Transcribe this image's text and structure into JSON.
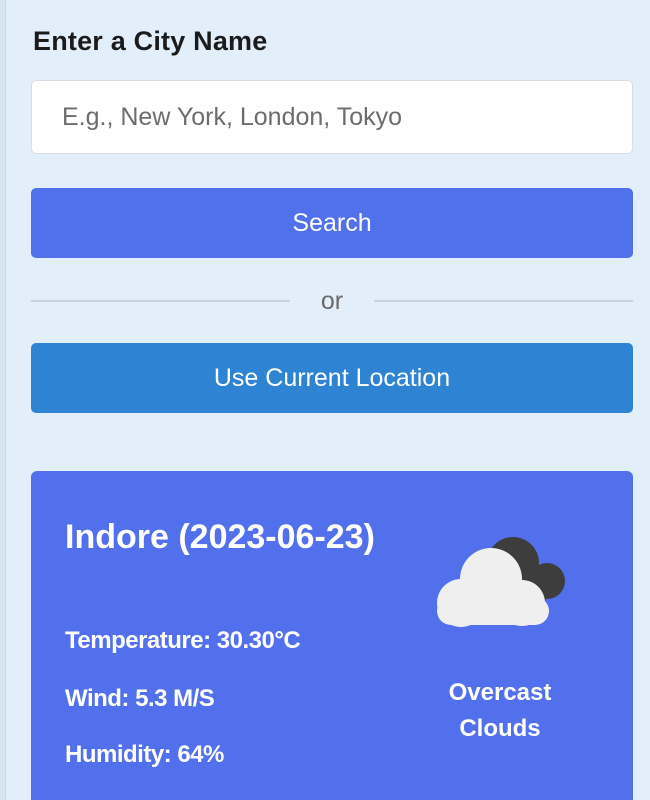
{
  "form": {
    "label": "Enter a City Name",
    "input_value": "",
    "input_placeholder": "E.g., New York, London, Tokyo",
    "search_label": "Search",
    "divider_text": "or",
    "location_label": "Use Current Location"
  },
  "current_weather": {
    "city_date": "Indore (2023-06-23)",
    "temperature": "Temperature: 30.30°C",
    "wind": "Wind: 5.3 M/S",
    "humidity": "Humidity: 64%",
    "condition": "Overcast Clouds",
    "icon": "overcast-clouds-icon"
  },
  "colors": {
    "page_bg": "#e2effb",
    "primary": "#5170ec",
    "secondary": "#2e84d3"
  }
}
